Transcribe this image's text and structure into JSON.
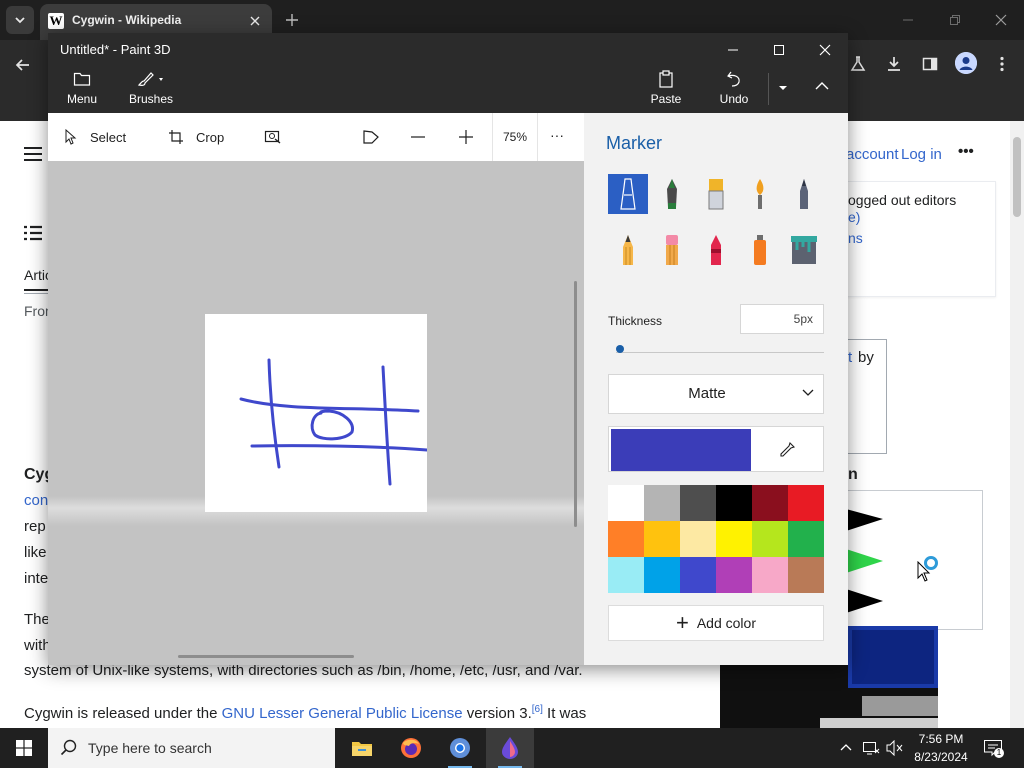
{
  "browser": {
    "tab_title": "Cygwin - Wikipedia",
    "tab_favicon": "W"
  },
  "wiki": {
    "account_link": "account",
    "login_link": "Log in",
    "more_menu": "•••",
    "notice_line1": "ogged out editors",
    "notice_line2": "e)",
    "notice_line3": "ns",
    "article_tab": "Artic",
    "from_text": "From",
    "box2_text1": "t",
    "box2_text2": "by",
    "heading_fragment": "Cyg",
    "line_con": "con",
    "line_rep": "rep",
    "line_like": "like",
    "line_inte": "inte",
    "line_the": "The",
    "line_with": "with",
    "infobox_caption_fragment": "n",
    "paragraph_line": "system of Unix-like systems, with directories such as /bin, /home, /etc, /usr, and /var.",
    "license_prefix": "Cygwin is released under the ",
    "license_link": "GNU Lesser General Public License",
    "license_suffix": " version 3.",
    "license_ref": "[6]",
    "license_tail": " It was"
  },
  "paint": {
    "window_title": "Untitled* - Paint 3D",
    "ribbon": {
      "menu_label": "Menu",
      "brushes_label": "Brushes",
      "paste_label": "Paste",
      "undo_label": "Undo"
    },
    "toolbar": {
      "select_label": "Select",
      "crop_label": "Crop",
      "zoom_value": "75%",
      "more_label": "···"
    },
    "panel": {
      "title": "Marker",
      "brushes": [
        {
          "name": "marker",
          "selected": true
        },
        {
          "name": "calligraphy-pen",
          "selected": false
        },
        {
          "name": "oil-brush",
          "selected": false
        },
        {
          "name": "watercolor",
          "selected": false
        },
        {
          "name": "pixel-pen",
          "selected": false
        },
        {
          "name": "pencil",
          "selected": false
        },
        {
          "name": "eraser",
          "selected": false
        },
        {
          "name": "crayon",
          "selected": false
        },
        {
          "name": "spray-can",
          "selected": false
        },
        {
          "name": "fill",
          "selected": false
        }
      ],
      "thickness_label": "Thickness",
      "thickness_value": "5px",
      "thickness_level": 0.02,
      "finish_value": "Matte",
      "current_color": "#3b3db8",
      "palette": [
        "#ffffff",
        "#b4b4b4",
        "#4e4e4e",
        "#000000",
        "#8a0f1e",
        "#e81b24",
        "#ff7f27",
        "#ffc20e",
        "#fde9a3",
        "#fff200",
        "#b5e61d",
        "#22b14c",
        "#99ecf5",
        "#00a2e8",
        "#3f48cc",
        "#b03fb7",
        "#f7a8c8",
        "#b97a57"
      ],
      "add_color_label": "Add color"
    }
  },
  "taskbar": {
    "search_placeholder": "Type here to search",
    "time": "7:56 PM",
    "date": "8/23/2024"
  }
}
